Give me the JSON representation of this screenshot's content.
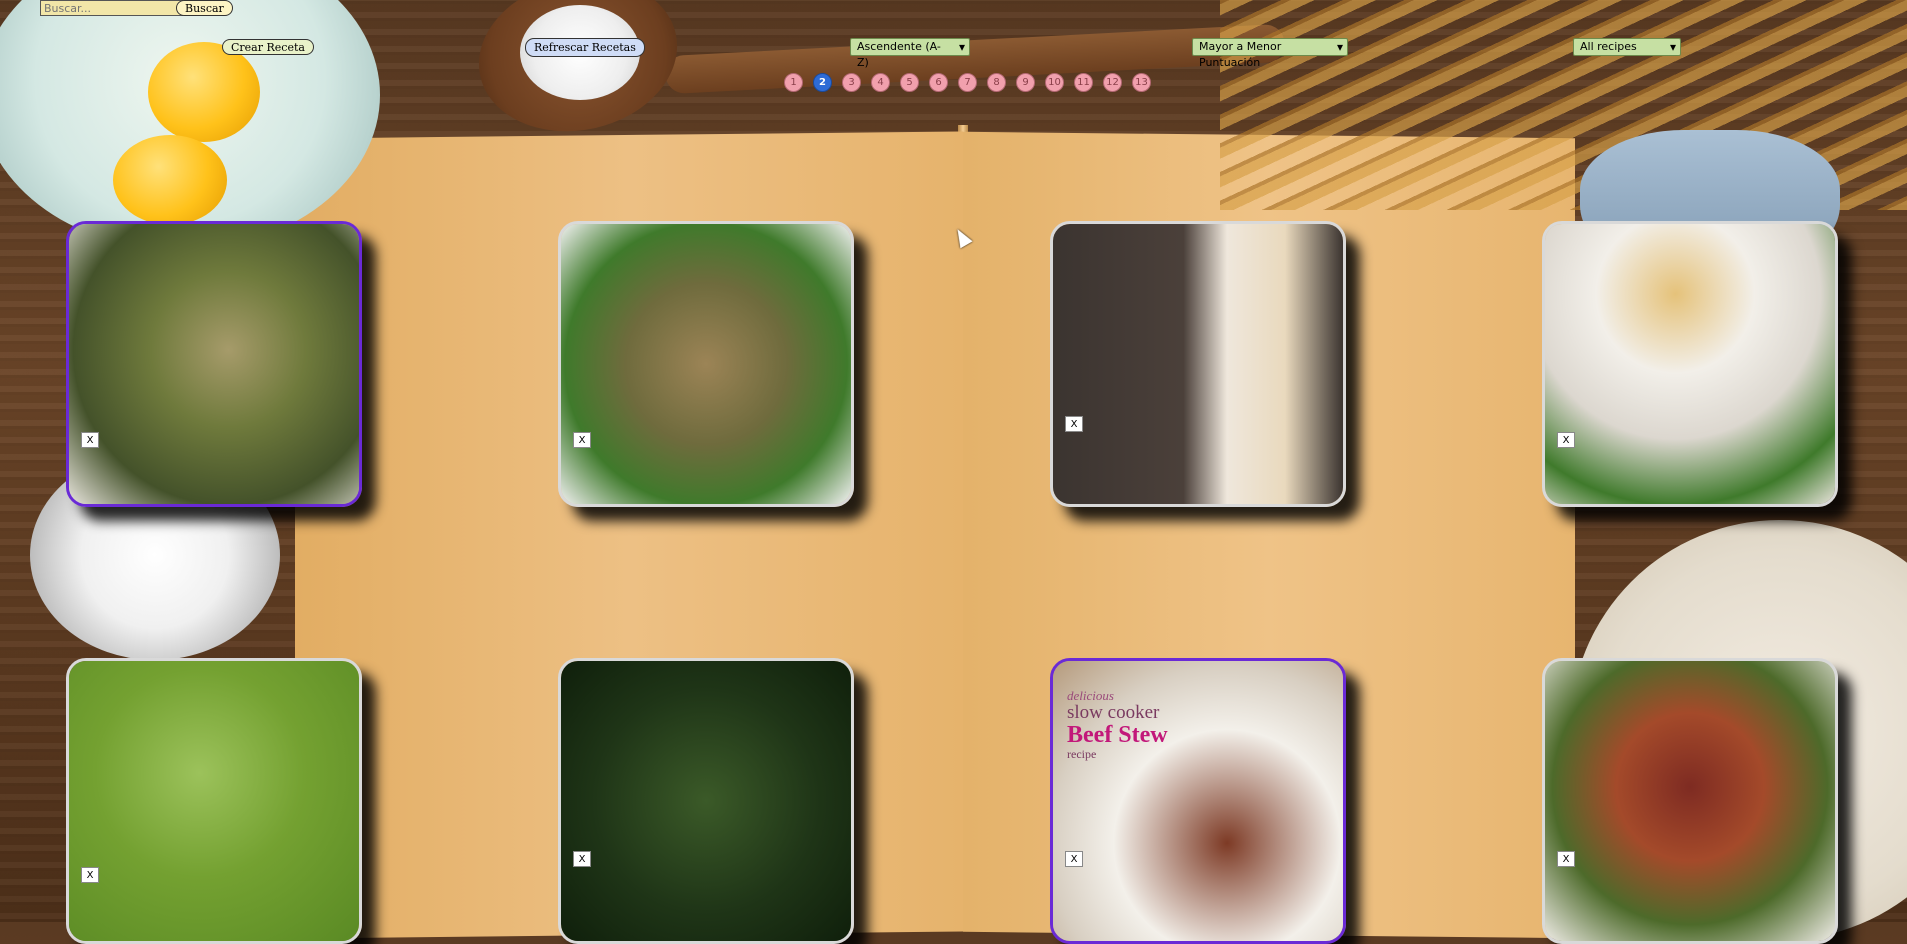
{
  "search": {
    "placeholder": "Buscar...",
    "value": "",
    "button_label": "Buscar"
  },
  "actions": {
    "create_label": "Crear Receta",
    "refresh_label": "Refrescar Recetas"
  },
  "filters": {
    "sort_order": "Ascendente (A-Z)",
    "score_order": "Mayor a Menor Puntuación",
    "diet_type": "All recipes"
  },
  "pagination": {
    "pages": [
      "1",
      "2",
      "3",
      "4",
      "5",
      "6",
      "7",
      "8",
      "9",
      "10",
      "11",
      "12",
      "13"
    ],
    "current": "2"
  },
  "recipes": [
    {
      "image": "asparagus-mushroom-beans",
      "delete_label": "X",
      "selected": true
    },
    {
      "image": "fried-rice-peas-broccoli",
      "delete_label": "X",
      "selected": false
    },
    {
      "image": "strawberry-smoothie",
      "delete_label": "X",
      "selected": false
    },
    {
      "image": "chicken-soup-bowls",
      "delete_label": "X",
      "selected": false
    },
    {
      "image": "green-pea-soup",
      "delete_label": "X",
      "selected": false
    },
    {
      "image": "sauteed-kale",
      "delete_label": "X",
      "selected": false
    },
    {
      "image": "slow-cooker-beef-stew",
      "delete_label": "X",
      "selected": true,
      "overlay_text": [
        "delicious",
        "slow cooker",
        "Beef Stew",
        "recipe"
      ]
    },
    {
      "image": "bean-rice-vegetable-stew",
      "delete_label": "X",
      "selected": false
    }
  ],
  "colors": {
    "active_page": "#2d6bd6",
    "page_bg": "#f1a0ad",
    "select_bg": "#c6e0a3",
    "selected_border": "#6a2ad6"
  }
}
